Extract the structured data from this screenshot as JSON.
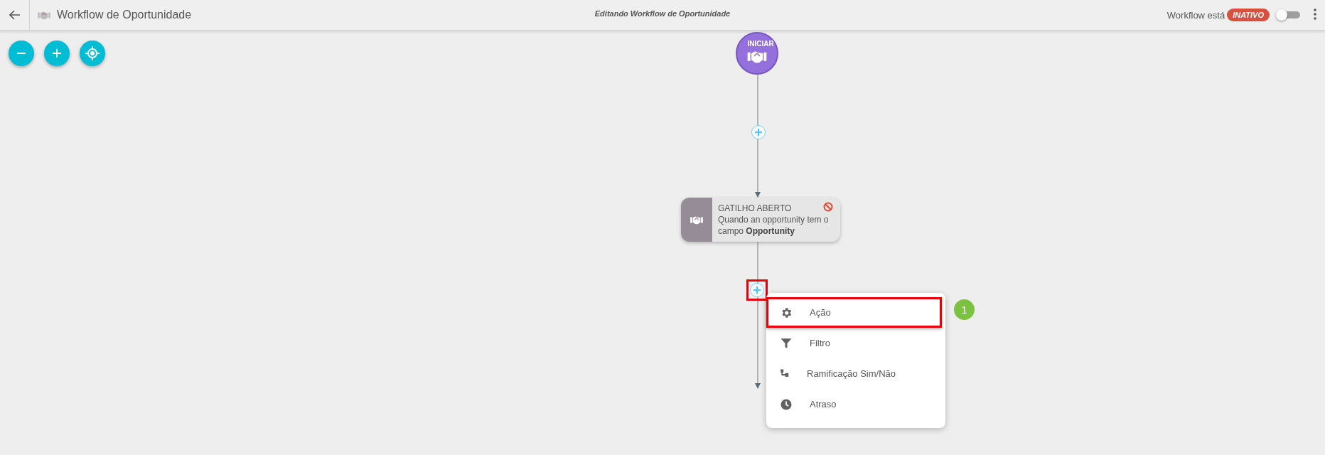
{
  "header": {
    "title": "Workflow de Oportunidade",
    "subtitle": "Editando Workflow de Oportunidade",
    "status_label": "Workflow está",
    "status_badge": "INATIVO",
    "toggle": {
      "on": false
    }
  },
  "canvas": {
    "start_node": {
      "label": "INICIAR"
    },
    "trigger_node": {
      "title": "GATILHO ABERTO",
      "description": "Quando an opportunity tem o campo **Opportunity**"
    },
    "add_menu": {
      "items": [
        {
          "kind": "action",
          "label": "Ação",
          "selected": true
        },
        {
          "kind": "filter",
          "label": "Filtro",
          "selected": false
        },
        {
          "kind": "branch",
          "label": "Ramificação Sim/Não",
          "selected": false
        },
        {
          "kind": "delay",
          "label": "Atraso",
          "selected": false
        }
      ]
    },
    "callout": {
      "number": "1"
    }
  }
}
